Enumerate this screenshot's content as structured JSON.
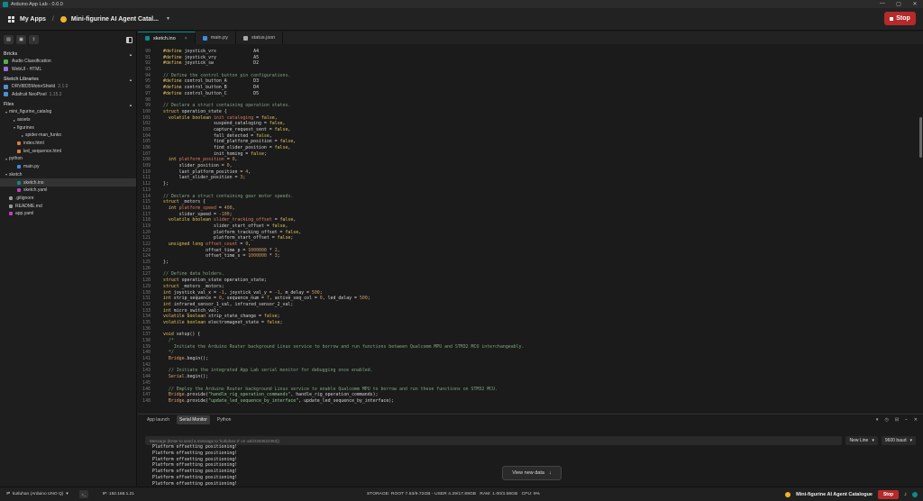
{
  "window": {
    "title": "Arduino App Lab - 0.0.0",
    "controls": [
      "—",
      "▢",
      "✕"
    ]
  },
  "header": {
    "my_apps": "My Apps",
    "separator": "/",
    "app_name": "Mini-figurine AI Agent Catal...",
    "stop_label": "Stop"
  },
  "sidebar": {
    "sections": {
      "bricks": "Bricks",
      "libraries": "Sketch Libraries",
      "files": "Files"
    },
    "bricks": [
      {
        "label": "Audio Classification",
        "color": "#4caf50"
      },
      {
        "label": "WebUI - HTML",
        "color": "#9c6bd6"
      }
    ],
    "libraries": [
      {
        "label": "DRV8835MotorShield",
        "version": "2.1.0",
        "color": "#4a90d9"
      },
      {
        "label": "Adafruit NeoPixel",
        "version": "1.15.2",
        "color": "#4a90d9"
      }
    ],
    "tree": [
      {
        "label": "mini_figurine_catalog",
        "depth": 0,
        "chev": "▾",
        "color": ""
      },
      {
        "label": "assets",
        "depth": 1,
        "chev": "▸",
        "color": ""
      },
      {
        "label": "figurines",
        "depth": 1,
        "chev": "▾",
        "color": ""
      },
      {
        "label": "spider-man_funko",
        "depth": 2,
        "chev": "▸",
        "color": ""
      },
      {
        "label": "index.html",
        "depth": 1,
        "chev": "",
        "color": "#e07a3a"
      },
      {
        "label": "led_sequence.html",
        "depth": 1,
        "chev": "",
        "color": "#e07a3a"
      },
      {
        "label": "python",
        "depth": 0,
        "chev": "▾",
        "color": ""
      },
      {
        "label": "main.py",
        "depth": 1,
        "chev": "",
        "color": "#3a8ee6"
      },
      {
        "label": "sketch",
        "depth": 0,
        "chev": "▾",
        "color": ""
      },
      {
        "label": "sketch.ino",
        "depth": 1,
        "chev": "",
        "color": "#0c8a8a",
        "selected": true
      },
      {
        "label": "sketch.yaml",
        "depth": 1,
        "chev": "",
        "color": "#c43ec4"
      },
      {
        "label": ".gitignore",
        "depth": 0,
        "chev": "",
        "color": "#999"
      },
      {
        "label": "README.md",
        "depth": 0,
        "chev": "",
        "color": "#999"
      },
      {
        "label": "app.yaml",
        "depth": 0,
        "chev": "",
        "color": "#c43ec4"
      }
    ]
  },
  "tabs": [
    {
      "label": "sketch.ino",
      "active": true,
      "color": "#0c8a8a",
      "close": "×"
    },
    {
      "label": "main.py",
      "active": false,
      "color": "#3a8ee6",
      "close": ""
    },
    {
      "label": "status.json",
      "active": false,
      "color": "#aaa",
      "close": ""
    }
  ],
  "code": [
    {
      "n": "90",
      "html": "<span class='k'>#define</span> joystick_vrx              A4"
    },
    {
      "n": "91",
      "html": "<span class='k'>#define</span> joystick_vry              A5"
    },
    {
      "n": "92",
      "html": "<span class='k'>#define</span> joystick_sw               D2"
    },
    {
      "n": "93",
      "html": ""
    },
    {
      "n": "94",
      "html": "<span class='c'>// Define the control button pin configurations.</span>"
    },
    {
      "n": "95",
      "html": "<span class='k'>#define</span> control_button_A          D3"
    },
    {
      "n": "96",
      "html": "<span class='k'>#define</span> control_button_B          D4"
    },
    {
      "n": "97",
      "html": "<span class='k'>#define</span> control_button_C          D5"
    },
    {
      "n": "98",
      "html": ""
    },
    {
      "n": "99",
      "html": "<span class='c'>// Declare a struct containing operation states.</span>"
    },
    {
      "n": "100",
      "html": "<span class='k'>struct</span> operation_state {"
    },
    {
      "n": "101",
      "html": "  <span class='k'>volatile boolean</span> <span class='v'>init_cataloging</span> = <span class='k'>false</span>,"
    },
    {
      "n": "102",
      "html": "                   suspend_cataloging = <span class='k'>false</span>,"
    },
    {
      "n": "103",
      "html": "                   capture_request_sent = <span class='k'>false</span>,"
    },
    {
      "n": "104",
      "html": "                   fall_detected = <span class='k'>false</span>,"
    },
    {
      "n": "105",
      "html": "                   find_platform_position = <span class='k'>false</span>,"
    },
    {
      "n": "106",
      "html": "                   find_slider_position = <span class='k'>false</span>,"
    },
    {
      "n": "107",
      "html": "                   init_homing = <span class='k'>false</span>;"
    },
    {
      "n": "108",
      "html": "  <span class='k'>int</span> <span class='v'>platform_position</span> = <span class='n'>0</span>,"
    },
    {
      "n": "109",
      "html": "      slider_position = <span class='n'>0</span>,"
    },
    {
      "n": "110",
      "html": "      last_platform_position = <span class='n'>4</span>,"
    },
    {
      "n": "111",
      "html": "      last_slider_position = <span class='n'>3</span>;"
    },
    {
      "n": "112",
      "html": "};"
    },
    {
      "n": "113",
      "html": ""
    },
    {
      "n": "114",
      "html": "<span class='c'>// Declare a struct containing gear motor speeds.</span>"
    },
    {
      "n": "115",
      "html": "<span class='k'>struct</span> _motors {"
    },
    {
      "n": "116",
      "html": "  <span class='k'>int</span> <span class='v'>platform_speed</span> = <span class='n'>400</span>,"
    },
    {
      "n": "117",
      "html": "      slider_speed = <span class='n'>-100</span>;"
    },
    {
      "n": "118",
      "html": "  <span class='k'>volatile boolean</span> <span class='v'>slider_tracking_offset</span> = <span class='k'>false</span>,"
    },
    {
      "n": "119",
      "html": "                   slider_start_offset = <span class='k'>false</span>,"
    },
    {
      "n": "120",
      "html": "                   platform_tracking_offset = <span class='k'>false</span>,"
    },
    {
      "n": "121",
      "html": "                   platform_start_offset = <span class='k'>false</span>;"
    },
    {
      "n": "122",
      "html": "  <span class='k'>unsigned long</span> <span class='v'>offset_count</span> = <span class='n'>0</span>,"
    },
    {
      "n": "123",
      "html": "                offset_time_p = <span class='n'>1000000</span> * <span class='n'>2</span>,"
    },
    {
      "n": "124",
      "html": "                offset_time_s = <span class='n'>1000000</span> * <span class='n'>3</span>;"
    },
    {
      "n": "125",
      "html": "};"
    },
    {
      "n": "126",
      "html": ""
    },
    {
      "n": "127",
      "html": "<span class='c'>// Define data holders.</span>"
    },
    {
      "n": "128",
      "html": "<span class='k'>struct</span> operation_state operation_state;"
    },
    {
      "n": "129",
      "html": "<span class='k'>struct</span> _motors _motors;"
    },
    {
      "n": "130",
      "html": "<span class='k'>int</span> joystick_val_x = <span class='n'>-1</span>, joystick_val_y = <span class='n'>-1</span>, m_delay = <span class='n'>500</span>;"
    },
    {
      "n": "131",
      "html": "<span class='k'>int</span> strip_sequence = <span class='n'>0</span>, sequence_num = <span class='n'>7</span>, active_seq_col = <span class='n'>0</span>, led_delay = <span class='n'>500</span>;"
    },
    {
      "n": "132",
      "html": "<span class='k'>int</span> infrared_sensor_1_val, infrared_sensor_2_val;"
    },
    {
      "n": "133",
      "html": "<span class='k'>int</span> micro_switch_val;"
    },
    {
      "n": "134",
      "html": "<span class='k'>volatile boolean</span> strip_state_change = <span class='k'>false</span>;"
    },
    {
      "n": "135",
      "html": "<span class='k'>volatile boolean</span> electromagnet_state = <span class='k'>false</span>;"
    },
    {
      "n": "136",
      "html": ""
    },
    {
      "n": "137",
      "html": "<span class='k'>void</span> setup() {"
    },
    {
      "n": "138",
      "html": "  <span class='c'>/*</span>"
    },
    {
      "n": "139",
      "html": "<span class='c'>    Initiate the Arduino Router background Linux service to borrow and run functions between Qualcomm MPU and STM32 MCU interchangeably.</span>"
    },
    {
      "n": "140",
      "html": "  <span class='c'>*/</span>"
    },
    {
      "n": "141",
      "html": "  <span class='f'>Bridge</span>.begin();"
    },
    {
      "n": "142",
      "html": ""
    },
    {
      "n": "143",
      "html": "  <span class='c'>// Initiate the integrated App Lab serial monitor for debugging once enabled.</span>"
    },
    {
      "n": "144",
      "html": "  <span class='f'>Serial</span>.begin();"
    },
    {
      "n": "145",
      "html": ""
    },
    {
      "n": "146",
      "html": "  <span class='c'>// Employ the Arduino Router background Linux service to enable Qualcomm MPU to borrow and run these functions on STM32 MCU.</span>"
    },
    {
      "n": "147",
      "html": "  <span class='f'>Bridge</span>.provide(<span class='s'>\"handle_rig_operation_commands\"</span>, handle_rig_operation_commands);"
    },
    {
      "n": "148",
      "html": "  <span class='f'>Bridge</span>.provide(<span class='s'>\"update_led_sequence_by_interface\"</span>, update_led_sequence_by_interface);"
    }
  ],
  "panel": {
    "tabs": [
      {
        "label": "App launch",
        "active": false
      },
      {
        "label": "Serial Monitor",
        "active": true
      },
      {
        "label": "Python",
        "active": false
      }
    ],
    "message_placeholder": "Message (Enter to send a message to 'kutluhan-2' on usb/2263622383))",
    "line_ending": "New Line",
    "baud": "9600 baud",
    "log_line": "Platform offsetting positioning!",
    "log_count": 7,
    "view_new_data": "View new data"
  },
  "status": {
    "board": "kutluhan (Arduino UNO Q)",
    "ip": "IP: 192.168.1.21",
    "storage": "STORAGE: ROOT 7.53/9.72GB - USER 4.29/17.89GB",
    "ram": "RAM: 1.00/3.58GB",
    "cpu": "CPU: 9%",
    "app_name": "Mini-figurine AI Agent Catalogue",
    "stop": "Stop"
  }
}
